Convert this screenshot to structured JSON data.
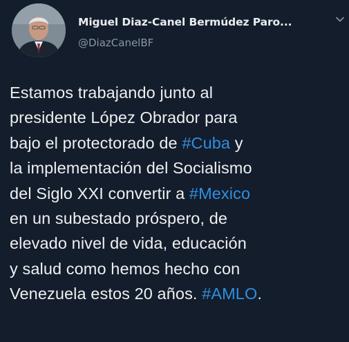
{
  "author": {
    "name": "Miguel Diaz-Canel Bermúdez Paro...",
    "handle": "@DiazCanelBF",
    "avatar_icon": "profile-photo",
    "menu_icon": "chevron-down-icon"
  },
  "tweet": {
    "lines": [
      [
        {
          "text": "Estamos trabajando junto al"
        }
      ],
      [
        {
          "text": "presidente López Obrador para"
        }
      ],
      [
        {
          "text": "bajo el protectorado de "
        },
        {
          "text": "#Cuba",
          "hashtag": true
        },
        {
          "text": " y"
        }
      ],
      [
        {
          "text": "la implementación del Socialismo"
        }
      ],
      [
        {
          "text": "del Siglo XXI convertir a "
        },
        {
          "text": "#Mexico",
          "hashtag": true
        }
      ],
      [
        {
          "text": "en un subestado próspero, de"
        }
      ],
      [
        {
          "text": "elevado nivel de vida, educación"
        }
      ],
      [
        {
          "text": "y salud como hemos hecho con"
        }
      ],
      [
        {
          "text": "Venezuela estos 20 años. "
        },
        {
          "text": "#AMLO",
          "hashtag": true
        },
        {
          "text": "."
        }
      ]
    ]
  },
  "colors": {
    "background": "#141d2b",
    "text": "#eef0f2",
    "handle": "#8a97a4",
    "hashtag": "#2f8fe0"
  }
}
